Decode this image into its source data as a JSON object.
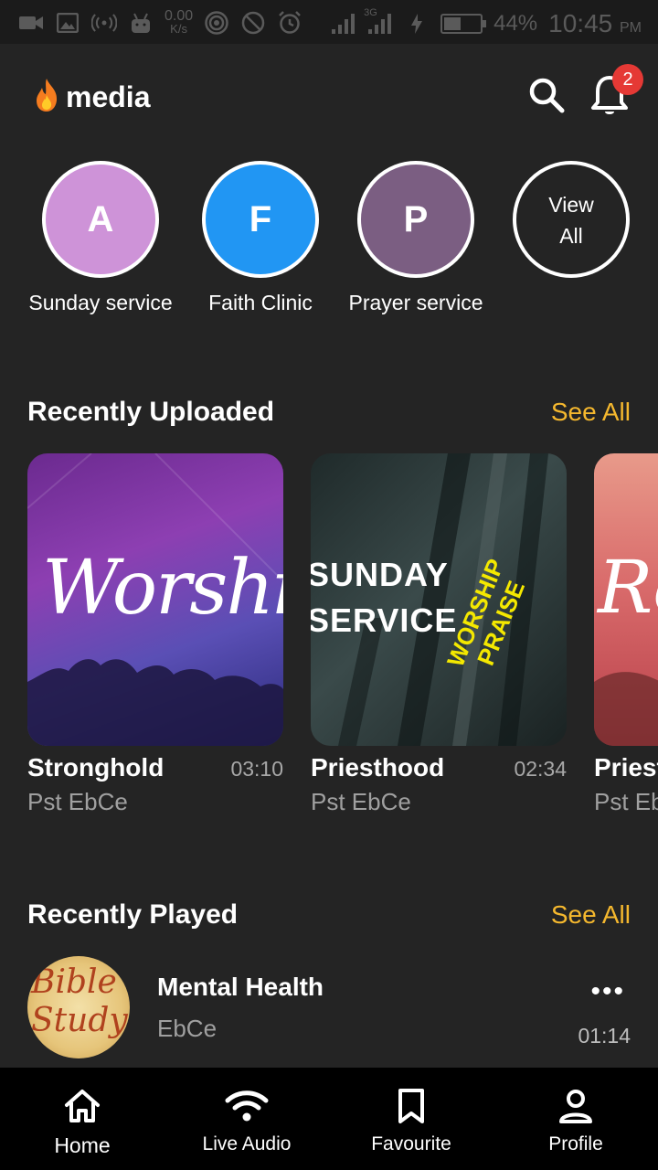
{
  "status_bar": {
    "speed_value": "0.00",
    "speed_unit": "K/s",
    "network": "3G",
    "battery": "44%",
    "time": "10:45",
    "ampm": "PM"
  },
  "header": {
    "app_name": "media",
    "notification_count": "2"
  },
  "categories": [
    {
      "initial": "A",
      "label": "Sunday service",
      "color": "#ce93d8"
    },
    {
      "initial": "F",
      "label": "Faith Clinic",
      "color": "#2196f3"
    },
    {
      "initial": "P",
      "label": "Prayer service",
      "color": "#7b5e82"
    }
  ],
  "view_all": {
    "line1": "View",
    "line2": "All"
  },
  "recently_uploaded": {
    "title": "Recently Uploaded",
    "see_all": "See All",
    "items": [
      {
        "title": "Stronghold",
        "duration": "03:10",
        "author": "Pst EbCe",
        "art_text": "Worship"
      },
      {
        "title": "Priesthood",
        "duration": "02:34",
        "author": "Pst EbCe",
        "art_line1": "SUNDAY",
        "art_line2": "SERVICE",
        "art_accent1": "WORSHIP",
        "art_accent2": "PRAISE"
      },
      {
        "title": "Priest",
        "author": "Pst Eb",
        "art_text": "Re"
      }
    ]
  },
  "recently_played": {
    "title": "Recently Played",
    "see_all": "See All",
    "items": [
      {
        "title": "Mental Health",
        "author": "EbCe",
        "duration": "01:14",
        "more": "•••",
        "art_line1": "Bible",
        "art_line2": "Study"
      }
    ]
  },
  "nav": [
    {
      "label": "Home",
      "icon": "home-icon",
      "active": true
    },
    {
      "label": "Live Audio",
      "icon": "wifi-icon"
    },
    {
      "label": "Favourite",
      "icon": "bookmark-icon"
    },
    {
      "label": "Profile",
      "icon": "person-icon"
    }
  ],
  "colors": {
    "accent": "#f5b82e",
    "background": "#242424",
    "badge": "#e53935"
  }
}
